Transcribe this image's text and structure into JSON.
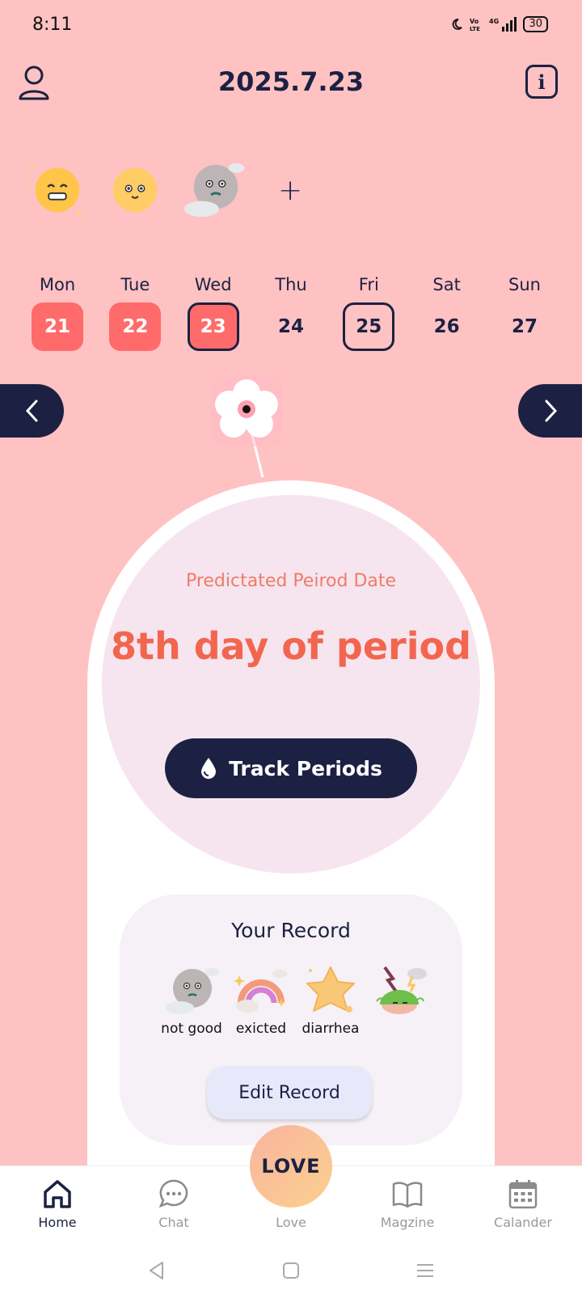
{
  "status_bar": {
    "time": "8:11",
    "battery": "30"
  },
  "header": {
    "date": "2025.7.23"
  },
  "moods": {
    "add_label": "+"
  },
  "week": [
    {
      "name": "Mon",
      "num": "21",
      "state": "period"
    },
    {
      "name": "Tue",
      "num": "22",
      "state": "period"
    },
    {
      "name": "Wed",
      "num": "23",
      "state": "selected"
    },
    {
      "name": "Thu",
      "num": "24",
      "state": "normal"
    },
    {
      "name": "Fri",
      "num": "25",
      "state": "outlined"
    },
    {
      "name": "Sat",
      "num": "26",
      "state": "normal"
    },
    {
      "name": "Sun",
      "num": "27",
      "state": "normal"
    }
  ],
  "prediction": {
    "label": "Predictated Peirod Date",
    "value": "8th day of period"
  },
  "track_button": {
    "label": "Track Periods"
  },
  "record": {
    "title": "Your Record",
    "items": [
      {
        "label": "not good",
        "icon": "moon-cloud-sticker-icon"
      },
      {
        "label": "exicted",
        "icon": "rainbow-sticker-icon"
      },
      {
        "label": "diarrhea",
        "icon": "star-splat-sticker-icon"
      },
      {
        "label": "",
        "icon": "storm-head-sticker-icon"
      }
    ],
    "edit_label": "Edit Record"
  },
  "fab": {
    "label": "LOVE"
  },
  "bottom_nav": [
    {
      "label": "Home",
      "icon": "home-icon",
      "active": true
    },
    {
      "label": "Chat",
      "icon": "chat-icon",
      "active": false
    },
    {
      "label": "Love",
      "icon": "love-icon",
      "active": false
    },
    {
      "label": "Magzine",
      "icon": "book-icon",
      "active": false
    },
    {
      "label": "Calander",
      "icon": "calendar-icon",
      "active": false
    }
  ],
  "colors": {
    "background": "#FFC2C2",
    "navy": "#1C2143",
    "period_red": "#FF6B6B",
    "accent_orange": "#F2664F"
  }
}
